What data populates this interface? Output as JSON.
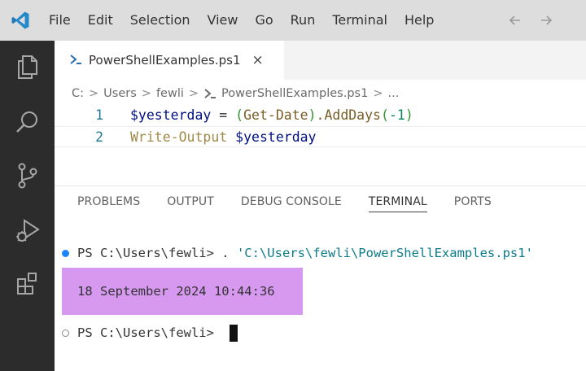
{
  "colors": {
    "titlebar_bg": "#dddddd",
    "activitybar_bg": "#2c2c2c",
    "vscode_blue": "#2489ca",
    "output_highlight": "#d799f0",
    "success_dot": "#1a85ff"
  },
  "menu": {
    "items": [
      "File",
      "Edit",
      "Selection",
      "View",
      "Go",
      "Run",
      "Terminal",
      "Help"
    ]
  },
  "activity_bar": {
    "icons": [
      "explorer-icon",
      "search-icon",
      "source-control-icon",
      "run-debug-icon",
      "extensions-icon"
    ]
  },
  "tab": {
    "label": "PowerShellExamples.ps1",
    "close": "×"
  },
  "breadcrumb": {
    "drive": "C:",
    "sep": ">",
    "users": "Users",
    "user": "fewli",
    "file": "PowerShellExamples.ps1",
    "more": "..."
  },
  "code": {
    "lines": [
      {
        "num": "1",
        "tokens": [
          "$yesterday",
          " = ",
          "(",
          "Get-Date",
          ")",
          ".AddDays",
          "(",
          "-1",
          ")"
        ]
      },
      {
        "num": "2",
        "tokens": [
          "Write-Output",
          " ",
          "$yesterday"
        ]
      }
    ]
  },
  "panel": {
    "tabs": [
      "PROBLEMS",
      "OUTPUT",
      "DEBUG CONSOLE",
      "TERMINAL",
      "PORTS"
    ],
    "active_tab": "TERMINAL"
  },
  "terminal": {
    "line1_prompt": "PS C:\\Users\\fewli> . ",
    "line1_path": "'C:\\Users\\fewli\\PowerShellExamples.ps1'",
    "output": "18 September 2024 10:44:36",
    "line3_prompt": "PS C:\\Users\\fewli> "
  }
}
